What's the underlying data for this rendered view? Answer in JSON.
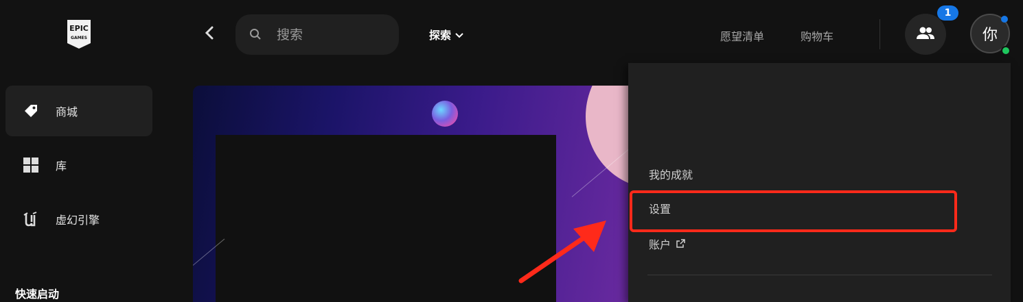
{
  "sidebar": {
    "logo_text": "EPIC GAMES",
    "items": [
      {
        "label": "商城",
        "icon": "tag-icon",
        "active": true
      },
      {
        "label": "库",
        "icon": "grid-icon",
        "active": false
      },
      {
        "label": "虚幻引擎",
        "icon": "unreal-engine-icon",
        "active": false
      }
    ],
    "quick_launch_title": "快速启动"
  },
  "topbar": {
    "back_icon": "chevron-left-icon",
    "search": {
      "placeholder": "搜索",
      "value": ""
    },
    "explore_label": "探索",
    "wishlist_label": "愿望清单",
    "cart_label": "购物车",
    "friends_badge": "1",
    "avatar_text": "你",
    "colors": {
      "notify": "#1677e6",
      "online": "#1ec75e"
    }
  },
  "account_menu": {
    "items": [
      {
        "label": "我的成就"
      },
      {
        "label": "设置",
        "highlighted": true
      },
      {
        "label": "账户",
        "external": true
      }
    ]
  },
  "annotation": {
    "highlight_color": "#ff2a1a"
  }
}
